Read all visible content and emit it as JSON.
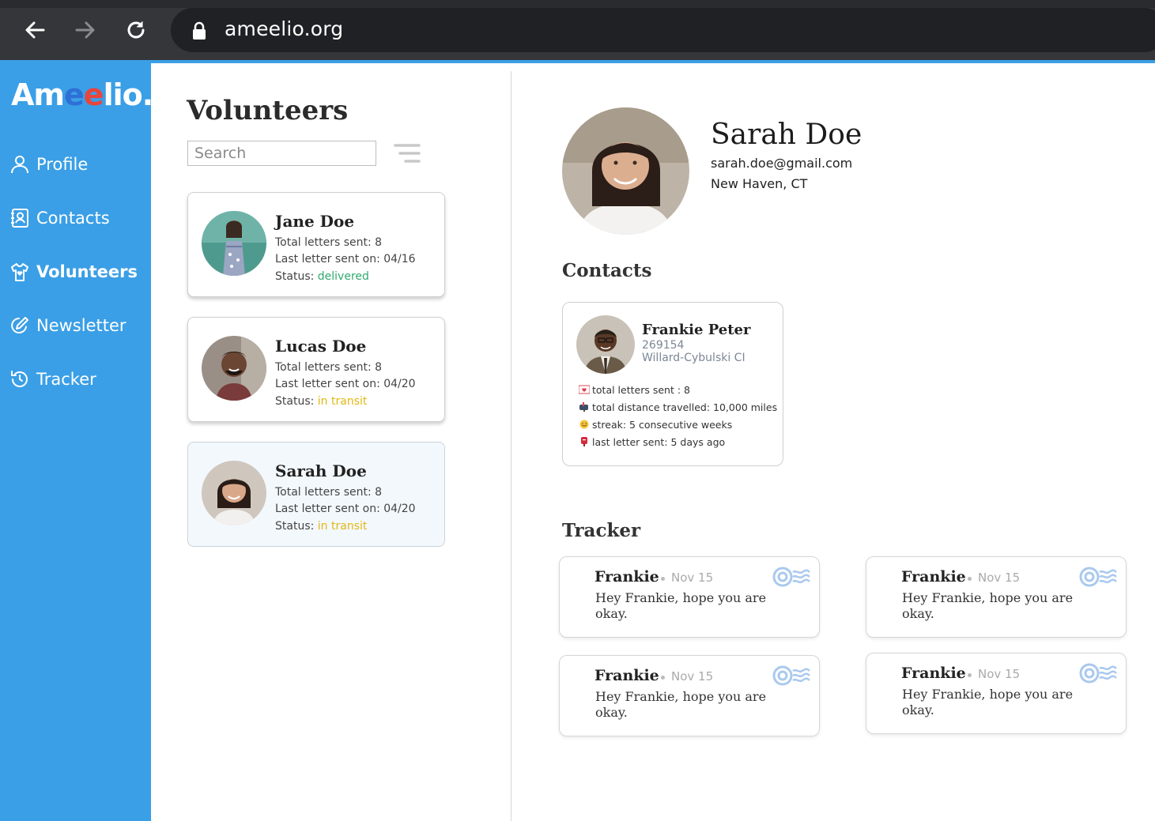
{
  "browser": {
    "url": "ameelio.org"
  },
  "app": {
    "logo": {
      "prefix": "Am",
      "e1": "e",
      "e2": "e",
      "suffix": "lio."
    },
    "accent_color": "#3a9fe6"
  },
  "sidebar": {
    "items": [
      {
        "label": "Profile",
        "icon": "user-icon",
        "active": false
      },
      {
        "label": "Contacts",
        "icon": "contacts-book-icon",
        "active": false
      },
      {
        "label": "Volunteers",
        "icon": "volunteer-shirt-icon",
        "active": true
      },
      {
        "label": "Newsletter",
        "icon": "edit-pencil-icon",
        "active": false
      },
      {
        "label": "Tracker",
        "icon": "history-icon",
        "active": false
      }
    ]
  },
  "volunteers": {
    "title": "Volunteers",
    "search_placeholder": "Search",
    "cards": [
      {
        "name": "Jane Doe",
        "letters": "Total letters sent: 8",
        "last": "Last letter sent on: 04/16",
        "status_label": "Status: ",
        "status": "delivered",
        "selected": false
      },
      {
        "name": "Lucas Doe",
        "letters": "Total letters sent: 8",
        "last": "Last letter sent on: 04/20",
        "status_label": "Status: ",
        "status": "in transit",
        "selected": false
      },
      {
        "name": "Sarah Doe",
        "letters": "Total letters sent: 8",
        "last": "Last letter sent on: 04/20",
        "status_label": "Status: ",
        "status": "in transit",
        "selected": true
      }
    ]
  },
  "profile": {
    "name": "Sarah Doe",
    "email": "sarah.doe@gmail.com",
    "location": "New Haven, CT"
  },
  "contacts": {
    "title": "Contacts",
    "card": {
      "name": "Frankie Peter",
      "id": "269154",
      "facility": "Willard-Cybulski CI",
      "stats": [
        {
          "icon": "love-letter-icon",
          "text": "total letters sent : 8"
        },
        {
          "icon": "mailbox-icon",
          "text": "total distance travelled: 10,000 miles"
        },
        {
          "icon": "smile-icon",
          "text": "streak: 5 consecutive weeks"
        },
        {
          "icon": "postbox-icon",
          "text": "last letter sent: 5 days ago"
        }
      ]
    }
  },
  "tracker": {
    "title": "Tracker",
    "items": [
      {
        "name": "Frankie",
        "date": "Nov 15",
        "message": "Hey Frankie, hope you are okay."
      },
      {
        "name": "Frankie",
        "date": "Nov 15",
        "message": "Hey Frankie, hope you are okay."
      },
      {
        "name": "Frankie",
        "date": "Nov 15",
        "message": "Hey Frankie, hope you are okay."
      },
      {
        "name": "Frankie",
        "date": "Nov 15",
        "message": "Hey Frankie, hope you are okay."
      }
    ]
  }
}
